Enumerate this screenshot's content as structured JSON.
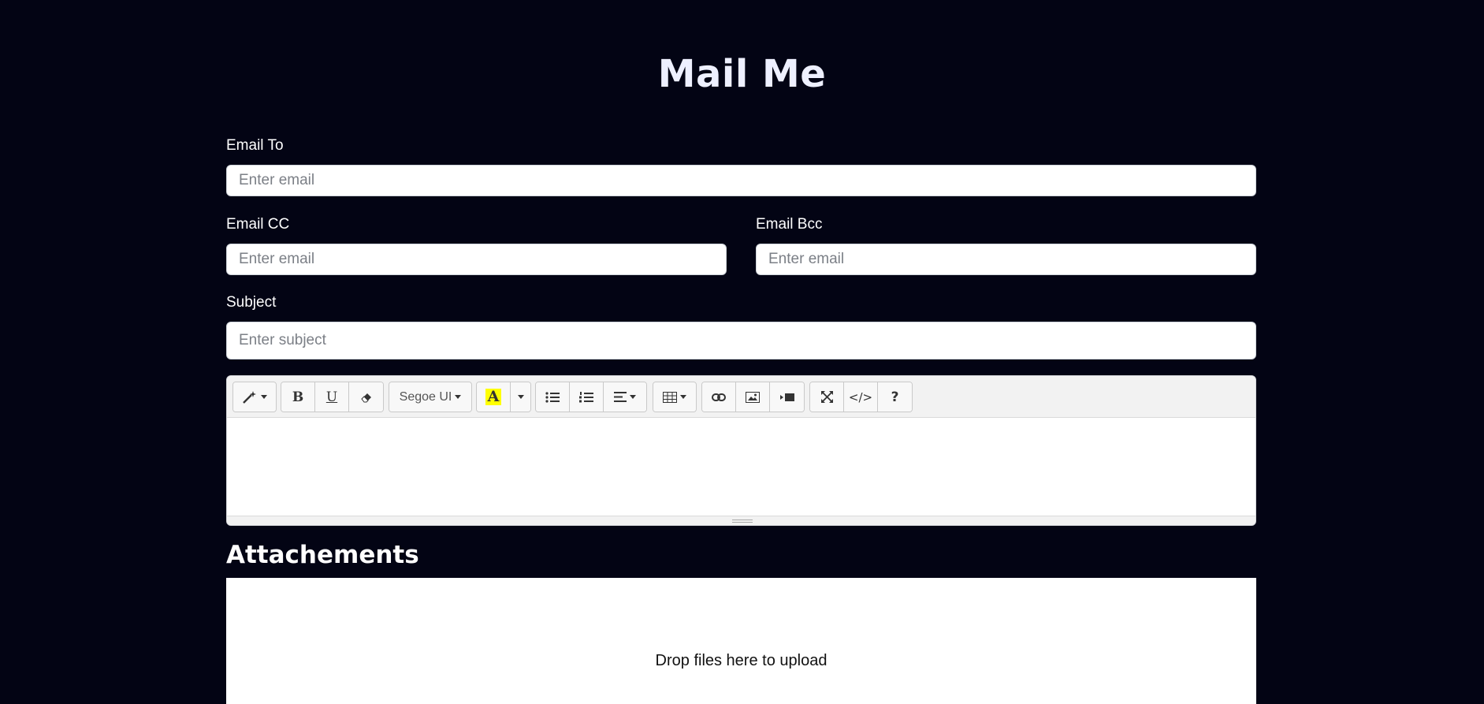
{
  "title": "Mail Me",
  "form": {
    "to": {
      "label": "Email To",
      "placeholder": "Enter email"
    },
    "cc": {
      "label": "Email CC",
      "placeholder": "Enter email"
    },
    "bcc": {
      "label": "Email Bcc",
      "placeholder": "Enter email"
    },
    "subject": {
      "label": "Subject",
      "placeholder": "Enter subject"
    }
  },
  "toolbar": {
    "style_icon": "magic-wand-icon",
    "bold": "B",
    "underline": "U",
    "clear_icon": "eraser-icon",
    "font_name": "Segoe UI",
    "color_letter": "A",
    "highlight_color": "#ffff00",
    "list_icons": [
      "unordered-list-icon",
      "ordered-list-icon",
      "paragraph-align-icon"
    ],
    "table_icon": "table-icon",
    "insert_icons": [
      "link-icon",
      "picture-icon",
      "video-icon"
    ],
    "view_icons": [
      "fullscreen-icon",
      "code-view-icon",
      "help-icon"
    ],
    "code_label": "</>",
    "help_label": "?"
  },
  "attachments": {
    "title": "Attachements",
    "drop_text": "Drop files here to upload"
  },
  "colors": {
    "background": "#030414",
    "accent": "#ffffff"
  }
}
